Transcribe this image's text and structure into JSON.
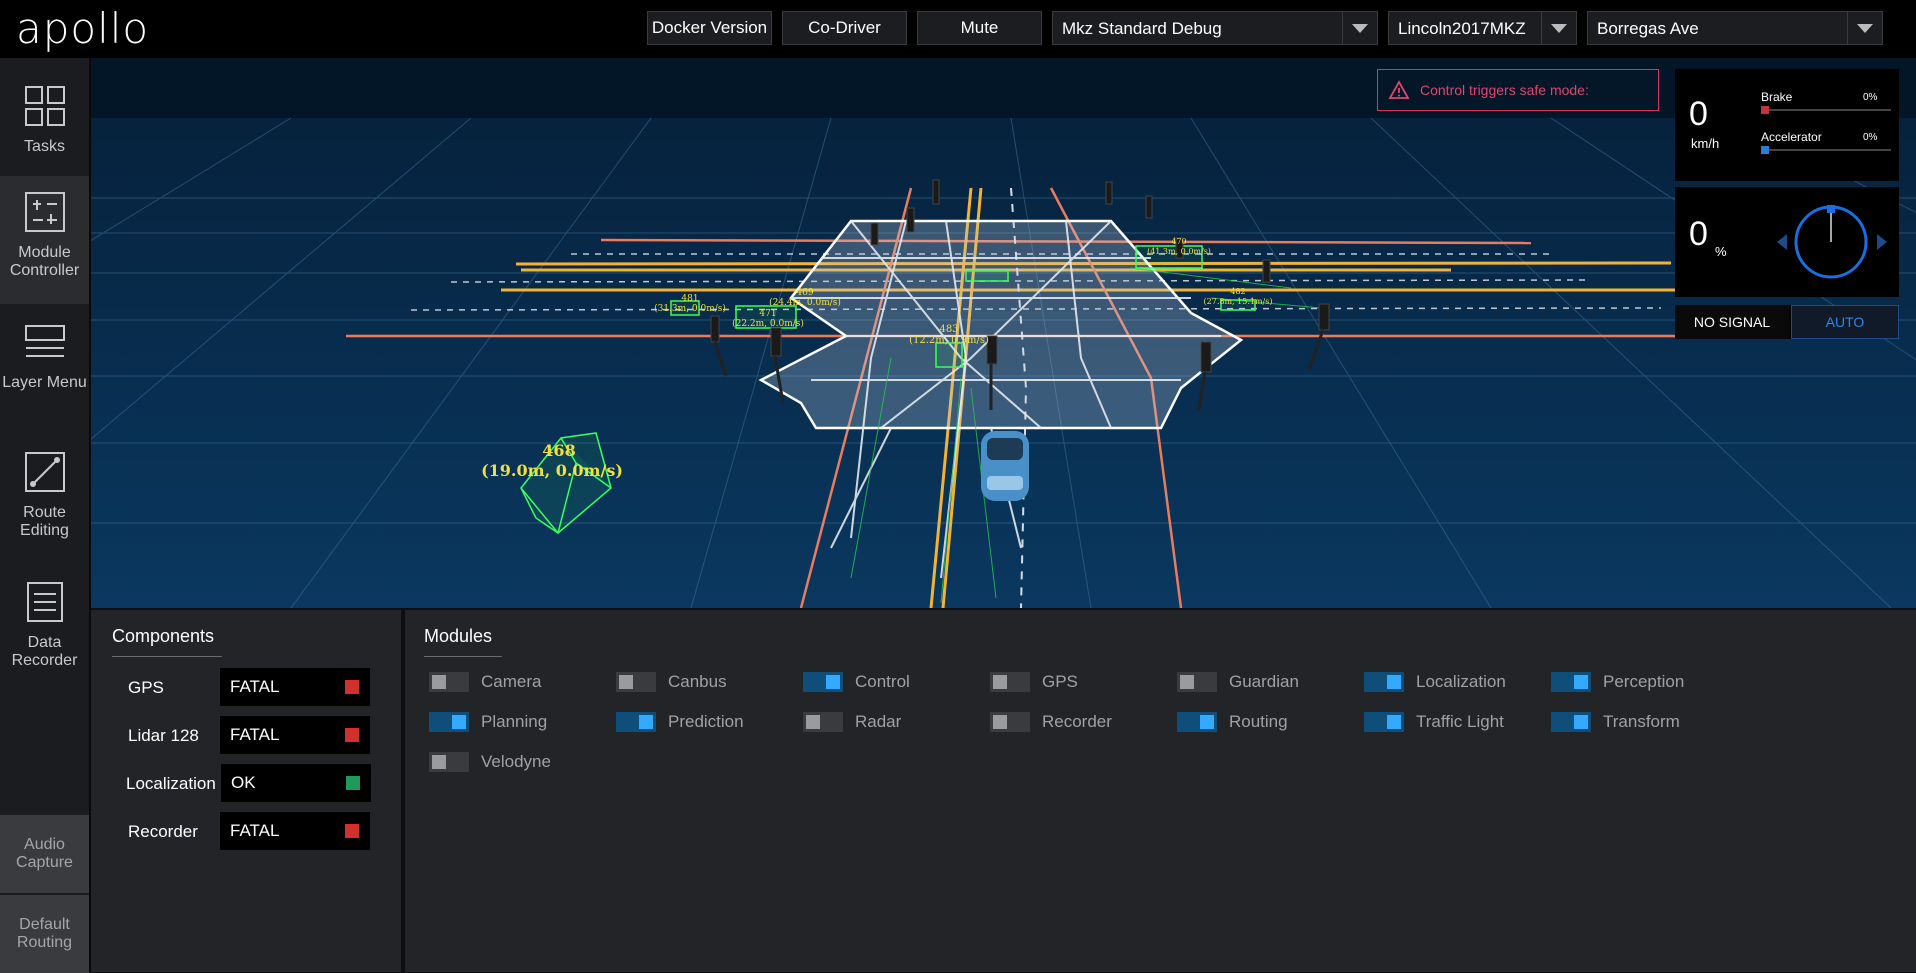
{
  "header": {
    "logo": "apollo",
    "buttons": [
      "Docker Version",
      "Co-Driver",
      "Mute"
    ],
    "mode_select": "Mkz Standard Debug",
    "vehicle_select": "Lincoln2017MKZ",
    "map_select": "Borregas Ave"
  },
  "sidebar": {
    "items": [
      {
        "label": "Tasks",
        "icon": "tasks-grid-icon"
      },
      {
        "label": "Module Controller",
        "icon": "module-controller-icon"
      },
      {
        "label": "Layer Menu",
        "icon": "layer-menu-icon"
      },
      {
        "label": "Route Editing",
        "icon": "route-editing-icon"
      },
      {
        "label": "Data Recorder",
        "icon": "data-recorder-icon"
      }
    ],
    "bottom": [
      "Audio Capture",
      "Default Routing"
    ]
  },
  "scene": {
    "alert": "Control triggers safe mode:",
    "obstacles": [
      {
        "id": "468",
        "info": "(19.0m, 0.0m/s)"
      },
      {
        "id": "481",
        "info": "(31.3m, 0.0m/s)"
      },
      {
        "id": "469",
        "info": "(24.4m, 0.0m/s)"
      },
      {
        "id": "471",
        "info": "(22.2m, 0.0m/s)"
      },
      {
        "id": "483",
        "info": "(12.2m, 0.9m/s)"
      },
      {
        "id": "470",
        "info": "(41.3m, 0.0m/s)"
      },
      {
        "id": "482",
        "info": "(27.8m, 15.1m/s)"
      }
    ]
  },
  "dashboard": {
    "speed_value": "0",
    "speed_unit": "km/h",
    "brake_label": "Brake",
    "brake_value": "0%",
    "accel_label": "Accelerator",
    "accel_value": "0%",
    "steering_value": "0",
    "steering_unit": "%",
    "signal_label": "NO SIGNAL",
    "drive_mode": "AUTO"
  },
  "components": {
    "title": "Components",
    "items": [
      {
        "name": "GPS",
        "status": "FATAL",
        "color": "#d0312d"
      },
      {
        "name": "Lidar 128",
        "status": "FATAL",
        "color": "#d0312d"
      },
      {
        "name": "Localization",
        "status": "OK",
        "color": "#1f9a5a"
      },
      {
        "name": "Recorder",
        "status": "FATAL",
        "color": "#d0312d"
      }
    ]
  },
  "modules": {
    "title": "Modules",
    "items": [
      {
        "name": "Camera",
        "on": false
      },
      {
        "name": "Canbus",
        "on": false
      },
      {
        "name": "Control",
        "on": true
      },
      {
        "name": "GPS",
        "on": false
      },
      {
        "name": "Guardian",
        "on": false
      },
      {
        "name": "Localization",
        "on": true
      },
      {
        "name": "Perception",
        "on": true
      },
      {
        "name": "Planning",
        "on": true
      },
      {
        "name": "Prediction",
        "on": true
      },
      {
        "name": "Radar",
        "on": false
      },
      {
        "name": "Recorder",
        "on": false
      },
      {
        "name": "Routing",
        "on": true
      },
      {
        "name": "Traffic Light",
        "on": true
      },
      {
        "name": "Transform",
        "on": true
      },
      {
        "name": "Velodyne",
        "on": false
      }
    ]
  }
}
